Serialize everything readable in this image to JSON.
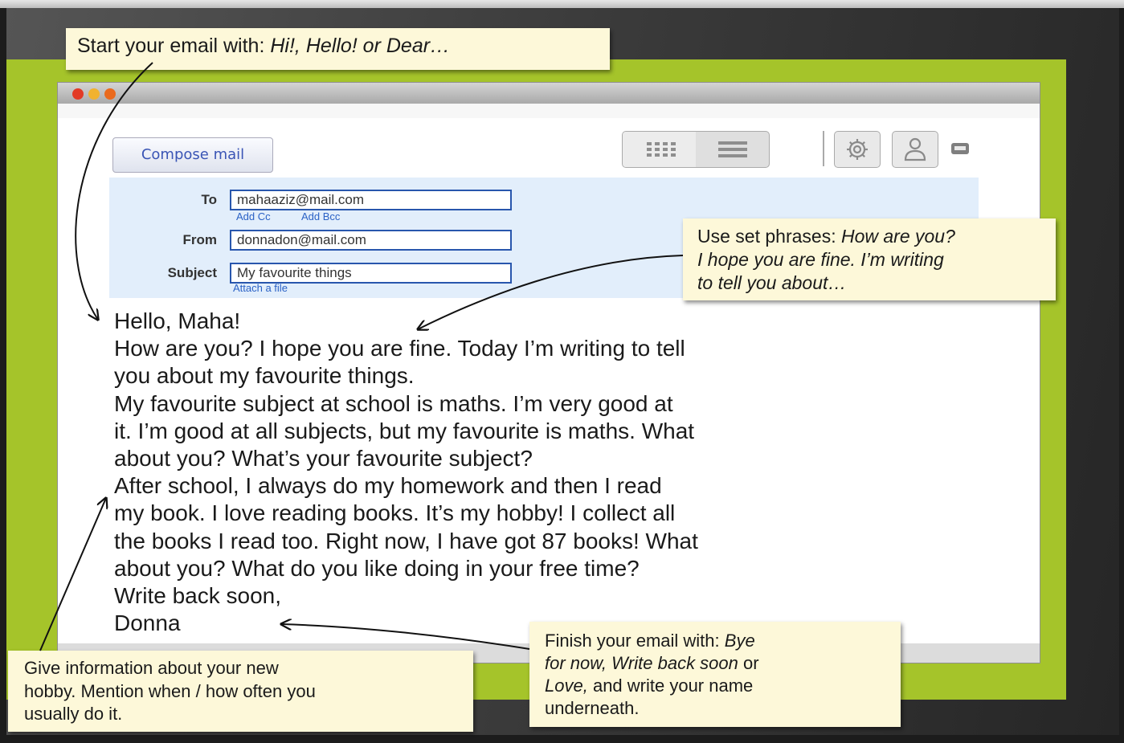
{
  "window": {
    "compose_label": "Compose mail",
    "to_label": "To",
    "to_value": "mahaaziz@mail.com",
    "add_cc": "Add Cc",
    "add_bcc": "Add Bcc",
    "from_label": "From",
    "from_value": "donnadon@mail.com",
    "subject_label": "Subject",
    "subject_value": "My favourite things",
    "attach_label": "Attach a file",
    "icons": [
      "grid-view-icon",
      "list-view-icon",
      "gear-icon",
      "user-icon",
      "minimize-icon"
    ]
  },
  "email_body": {
    "lines": [
      "Hello, Maha!",
      "How are you? I hope you are fine. Today I’m writing to tell",
      "you about my favourite things.",
      "My favourite subject at school is maths. I’m very good at",
      "it. I’m good at all subjects, but my favourite is maths. What",
      "about you? What’s your favourite subject?",
      "After school, I always do my homework and then I read",
      "my book. I love reading books. It’s my hobby! I collect all",
      "the books I read too. Right now, I have got 87 books! What",
      "about you? What do you like doing in your free time?",
      "Write back soon,",
      "Donna"
    ]
  },
  "notes": {
    "start": {
      "text": "Start your email with:",
      "examples": "Hi!, Hello! or Dear…"
    },
    "phrases": {
      "line1_plain": "Use set phrases:",
      "line1_italic": "How are you?",
      "line2": "I hope you are fine. I’m writing",
      "line3": "to tell you about…"
    },
    "hobby": {
      "line1": "Give information about your new",
      "line2": "hobby. Mention when / how often you",
      "line3": "usually do it."
    },
    "finish": {
      "line1_plain": "Finish your email with:",
      "line1_italic": "Bye",
      "line2_italic": "for now, Write back soon",
      "line2_plain": "or",
      "line3_italic": "Love,",
      "line3_plain": "and write your name",
      "line4": "underneath."
    }
  },
  "colors": {
    "green_frame": "#a5c42a",
    "note_bg": "#fdf8d9",
    "header_bg": "#e2eefb",
    "field_border": "#2856ad",
    "link_blue": "#2b62c6"
  }
}
